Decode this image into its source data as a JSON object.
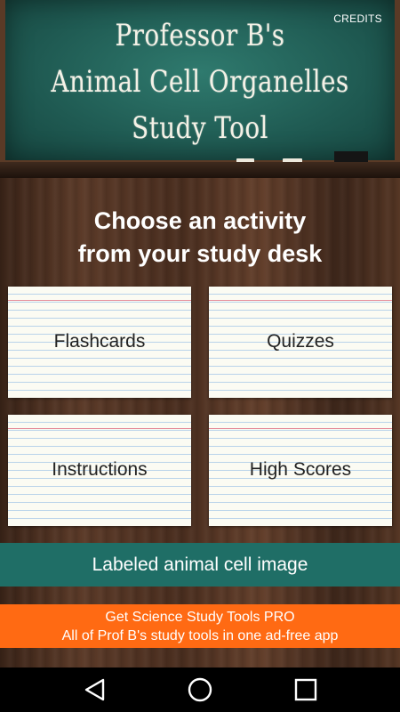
{
  "header": {
    "title_lines": [
      "Professor B's",
      "Animal Cell Organelles",
      "Study Tool"
    ],
    "credits_label": "CREDITS"
  },
  "main": {
    "heading_lines": [
      "Choose an activity",
      "from your study desk"
    ],
    "cards": [
      {
        "label": "Flashcards"
      },
      {
        "label": "Quizzes"
      },
      {
        "label": "Instructions"
      },
      {
        "label": "High Scores"
      }
    ],
    "image_button_label": "Labeled animal cell image"
  },
  "promo": {
    "line1": "Get Science Study Tools PRO",
    "line2": "All of Prof B's study tools in one ad-free app"
  },
  "navbar": {
    "icons": [
      "back-icon",
      "home-icon",
      "recents-icon"
    ]
  },
  "colors": {
    "chalkboard": "#1f5a52",
    "teal_button": "#1f6e66",
    "orange_banner": "#ff6a13"
  }
}
